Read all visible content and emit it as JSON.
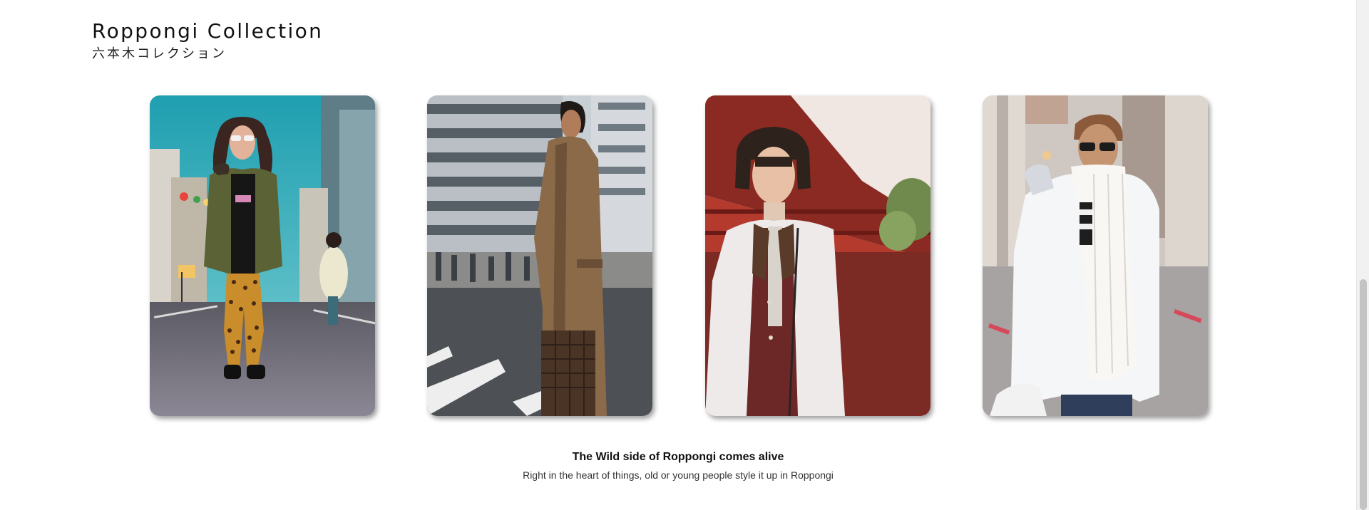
{
  "header": {
    "title": "Roppongi Collection",
    "subtitle": "六本木コレクション"
  },
  "gallery": {
    "photos": [
      {
        "name": "street-style-photo-1",
        "icon": "photo-icon"
      },
      {
        "name": "street-style-photo-2",
        "icon": "photo-icon"
      },
      {
        "name": "street-style-photo-3",
        "icon": "photo-icon"
      },
      {
        "name": "street-style-photo-4",
        "icon": "photo-icon"
      }
    ]
  },
  "caption": {
    "heading": "The Wild side of Roppongi comes alive",
    "text": "Right in the heart of things, old or young people style it up in Roppongi"
  },
  "scrollbar": {
    "position": 0.55
  },
  "colors": {
    "background": "#ffffff",
    "text": "#111111",
    "scrollbar_track": "#f1f1f1",
    "scrollbar_thumb": "#c3c3c3"
  }
}
